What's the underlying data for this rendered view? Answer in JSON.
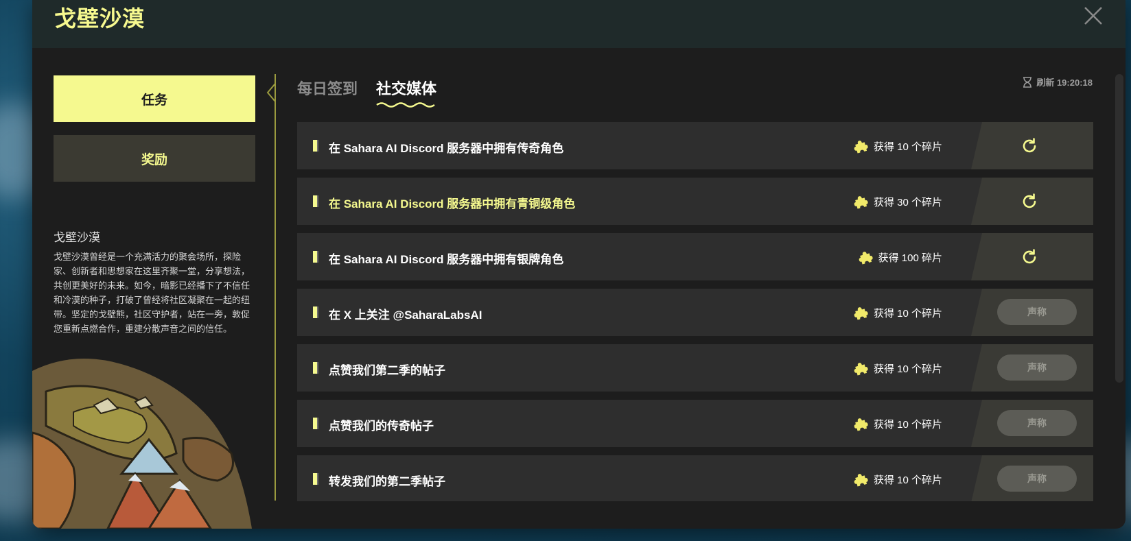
{
  "modal": {
    "title": "戈壁沙漠"
  },
  "sidebar": {
    "tabs": [
      {
        "label": "任务"
      },
      {
        "label": "奖励"
      }
    ],
    "description": {
      "title": "戈壁沙漠",
      "text": "戈壁沙漠曾经是一个充满活力的聚会场所，探险家、创新者和思想家在这里齐聚一堂，分享想法，共创更美好的未来。如今，暗影已经播下了不信任和冷漠的种子，打破了曾经将社区凝聚在一起的纽带。坚定的戈壁熊，社区守护者，站在一旁，敦促您重新点燃合作，重建分散声音之间的信任。"
    }
  },
  "main": {
    "tabs": [
      {
        "label": "每日签到"
      },
      {
        "label": "社交媒体"
      }
    ],
    "refresh_label": "刷新 19:20:18",
    "tasks": [
      {
        "name": "在 Sahara AI Discord 服务器中拥有传奇角色",
        "reward": "获得 10 个碎片",
        "action": "refresh"
      },
      {
        "name": "在 Sahara AI Discord 服务器中拥有青铜级角色",
        "reward": "获得 30 个碎片",
        "action": "refresh"
      },
      {
        "name": "在 Sahara AI Discord 服务器中拥有银牌角色",
        "reward": "获得 100 碎片",
        "action": "refresh"
      },
      {
        "name": "在 X 上关注 @SaharaLabsAI",
        "reward": "获得 10 个碎片",
        "action": "claim",
        "action_label": "声称"
      },
      {
        "name": "点赞我们第二季的帖子",
        "reward": "获得 10 个碎片",
        "action": "claim",
        "action_label": "声称"
      },
      {
        "name": "点赞我们的传奇帖子",
        "reward": "获得 10 个碎片",
        "action": "claim",
        "action_label": "声称"
      },
      {
        "name": "转发我们的第二季帖子",
        "reward": "获得 10 个碎片",
        "action": "claim",
        "action_label": "声称"
      }
    ]
  },
  "colors": {
    "accent": "#f5f98f",
    "panel": "#1d1d1d",
    "row": "#2e2e2e"
  },
  "icons": {
    "close": "close-icon",
    "refresh": "refresh-icon",
    "timer": "hourglass-icon",
    "reward": "puzzle-piece-icon"
  }
}
